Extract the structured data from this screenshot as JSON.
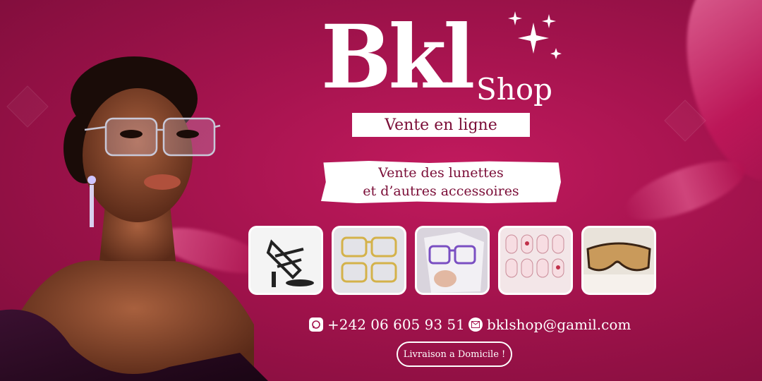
{
  "brand": {
    "name": "Bkl",
    "suffix": "Shop",
    "tagline": "Vente en ligne"
  },
  "description": {
    "line1": "Vente des lunettes",
    "line2": "et d’autres accessoires"
  },
  "products": [
    {
      "name": "sandals-photo-icon"
    },
    {
      "name": "gold-glasses-photo-icon"
    },
    {
      "name": "purple-glasses-photo-icon"
    },
    {
      "name": "press-on-nails-photo-icon"
    },
    {
      "name": "tinted-sunglasses-photo-icon"
    }
  ],
  "contact": {
    "phone": "+242 06 605 93 51",
    "phone_icon": "whatsapp-icon",
    "email": "bklshop@gamil.com",
    "email_icon": "mail-icon"
  },
  "cta": {
    "label": "Livraison a Domicile !"
  },
  "colors": {
    "background": "#a3134d",
    "accent_text": "#7a0d37",
    "white": "#ffffff"
  }
}
